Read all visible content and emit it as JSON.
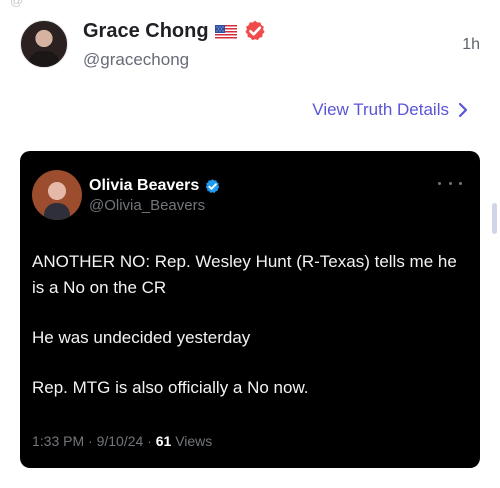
{
  "topbar": {
    "fragment": "@"
  },
  "post": {
    "author_name": "Grace Chong",
    "author_handle": "@gracechong",
    "timestamp": "1h",
    "details_label": "View Truth Details"
  },
  "embedded_post": {
    "author_name": "Olivia Beavers",
    "author_handle": "@Olivia_Beavers",
    "paragraphs": [
      "ANOTHER NO: Rep. Wesley Hunt (R-Texas) tells me he is a No on the CR",
      "He was undecided yesterday",
      "Rep. MTG is also officially a No now."
    ],
    "meta_prefix": "1:33 PM · 9/10/24 · ",
    "views_count": "61",
    "views_label": "Views"
  },
  "icons": {
    "flag": "us-flag-icon",
    "verified": "verified-icon",
    "chevron": "chevron-right-icon",
    "more": "more-icon"
  },
  "colors": {
    "link": "#5a55d6",
    "verified_red": "#f04b4b",
    "verified_blue": "#1d9bf0",
    "embed_background": "#000000"
  }
}
